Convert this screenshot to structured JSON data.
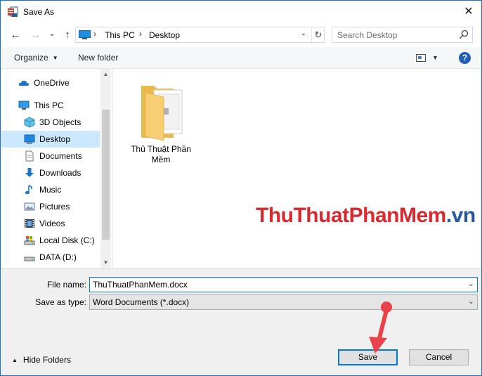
{
  "window": {
    "title": "Save As",
    "close_glyph": "✕"
  },
  "nav_buttons": {
    "back_glyph": "←",
    "forward_glyph": "→",
    "recent_glyph": "⌄",
    "up_glyph": "↑"
  },
  "address": {
    "crumbs": [
      "This PC",
      "Desktop"
    ],
    "separator": "›",
    "dropdown_glyph": "⌄",
    "refresh_glyph": "↻"
  },
  "search": {
    "placeholder": "Search Desktop"
  },
  "toolbar": {
    "organize_label": "Organize",
    "caret_glyph": "▼",
    "new_folder_label": "New folder",
    "help_label": "?"
  },
  "sidebar": {
    "items": [
      {
        "label": "OneDrive",
        "icon": "cloud-icon"
      },
      {
        "label": "This PC",
        "icon": "computer-icon"
      },
      {
        "label": "3D Objects",
        "icon": "cube-icon"
      },
      {
        "label": "Desktop",
        "icon": "desktop-icon",
        "selected": true
      },
      {
        "label": "Documents",
        "icon": "documents-icon"
      },
      {
        "label": "Downloads",
        "icon": "download-icon"
      },
      {
        "label": "Music",
        "icon": "music-icon"
      },
      {
        "label": "Pictures",
        "icon": "pictures-icon"
      },
      {
        "label": "Videos",
        "icon": "videos-icon"
      },
      {
        "label": "Local Disk (C:)",
        "icon": "drive-icon"
      },
      {
        "label": "DATA (D:)",
        "icon": "drive-icon"
      }
    ],
    "scroll_up_glyph": "▲",
    "scroll_down_glyph": "▼"
  },
  "content": {
    "items": [
      {
        "label": "Thủ Thuật Phần Mềm",
        "type": "folder"
      }
    ],
    "watermark_main": "ThuThuatPhanMem",
    "watermark_suffix": ".vn"
  },
  "form": {
    "filename_label": "File name:",
    "filename_value": "ThuThuatPhanMem.docx",
    "savetype_label": "Save as type:",
    "savetype_value": "Word Documents (*.docx)",
    "caret_glyph": "⌄"
  },
  "footer": {
    "hide_folders_label": "Hide Folders",
    "hide_caret_glyph": "▲",
    "save_label": "Save",
    "cancel_label": "Cancel"
  },
  "colors": {
    "accent": "#0078d7",
    "selection": "#cce8ff",
    "folder": "#f4c76a",
    "pointer": "#e8424a"
  }
}
